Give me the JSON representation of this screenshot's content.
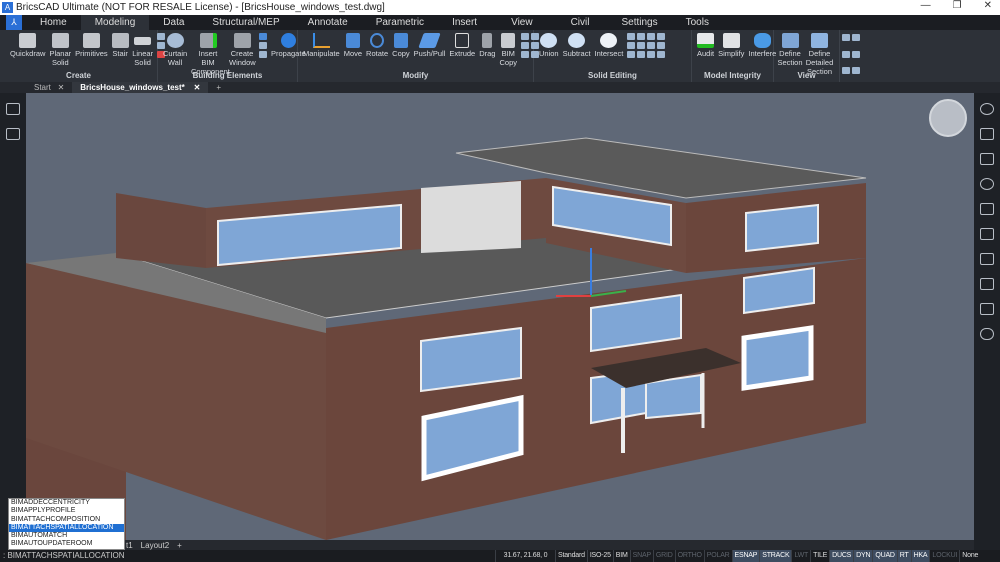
{
  "window": {
    "title": "BricsCAD Ultimate (NOT FOR RESALE License) - [BricsHouse_windows_test.dwg]",
    "minimize": "—",
    "restore": "❐",
    "close": "✕"
  },
  "menu": {
    "tabs": [
      "Home",
      "Modeling",
      "Data",
      "Structural/MEP",
      "Annotate",
      "Parametric",
      "Insert",
      "View",
      "Civil",
      "Settings",
      "Tools"
    ],
    "active": "Modeling"
  },
  "ribbon": {
    "groups": [
      {
        "label": "Create",
        "tools": [
          "Quickdraw",
          "Planar Solid",
          "Primitives",
          "Stair",
          "Linear Solid"
        ]
      },
      {
        "label": "Building Elements",
        "tools": [
          "Curtain Wall",
          "Insert BIM Component",
          "Create Window",
          "Propagate"
        ]
      },
      {
        "label": "Modify",
        "tools": [
          "Manipulate",
          "Move",
          "Rotate",
          "Copy",
          "Push/Pull",
          "Extrude",
          "Drag",
          "BIM Copy"
        ]
      },
      {
        "label": "Solid Editing",
        "tools": [
          "Union",
          "Subtract",
          "Intersect"
        ]
      },
      {
        "label": "Model Integrity",
        "tools": [
          "Audit",
          "Simplify",
          "Interfere"
        ]
      },
      {
        "label": "View",
        "tools": [
          "Define Section",
          "Define Detailed Section"
        ]
      }
    ]
  },
  "doc_tabs": {
    "tabs": [
      "Start",
      "BricsHouse_windows_test*"
    ],
    "close": "✕",
    "add": "+"
  },
  "layout_tabs": [
    "t1",
    "Layout2",
    "+"
  ],
  "autocomplete": {
    "items": [
      "BIMADDECCENTRICITY",
      "BIMAPPLYPROFILE",
      "BIMATTACHCOMPOSITION",
      "BIMATTACHSPATIALLOCATION",
      "BIMAUTOMATCH",
      "BIMAUTOUPDATEROOM"
    ],
    "selected": 3
  },
  "command_line": ": BIMATTACHSPATIALLOCATION",
  "status": {
    "coords": "31.67, 21.68, 0",
    "items": [
      {
        "label": "Standard",
        "state": "plain"
      },
      {
        "label": "ISO-25",
        "state": "plain"
      },
      {
        "label": "BIM",
        "state": "plain"
      },
      {
        "label": "SNAP",
        "state": "off"
      },
      {
        "label": "GRID",
        "state": "off"
      },
      {
        "label": "ORTHO",
        "state": "off"
      },
      {
        "label": "POLAR",
        "state": "off"
      },
      {
        "label": "ESNAP",
        "state": "on"
      },
      {
        "label": "STRACK",
        "state": "on"
      },
      {
        "label": "LWT",
        "state": "off"
      },
      {
        "label": "TILE",
        "state": "plain"
      },
      {
        "label": "DUCS",
        "state": "on"
      },
      {
        "label": "DYN",
        "state": "on"
      },
      {
        "label": "QUAD",
        "state": "on"
      },
      {
        "label": "RT",
        "state": "on"
      },
      {
        "label": "HKA",
        "state": "on"
      },
      {
        "label": "LOCKUI",
        "state": "off"
      },
      {
        "label": "None",
        "state": "plain"
      }
    ]
  },
  "colors": {
    "accent": "#1f6fd2",
    "viewport": "#5f6877",
    "brick": "#6e4a40",
    "glass": "#7fa6d6"
  }
}
